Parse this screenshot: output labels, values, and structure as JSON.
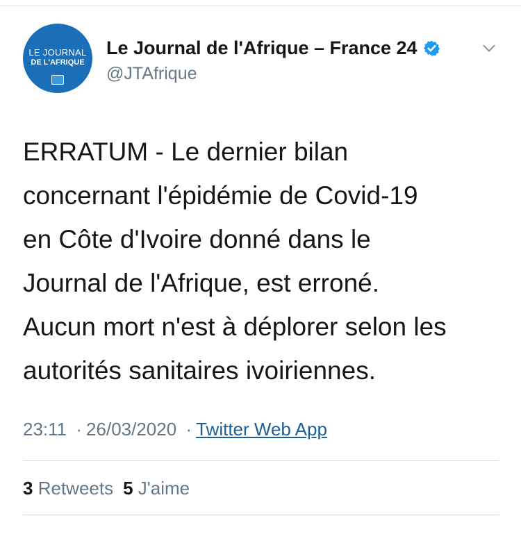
{
  "account": {
    "display_name": "Le Journal de l'Afrique – France 24",
    "handle": "@JTAfrique",
    "verified": true,
    "avatar_line1": "LE JOURNAL",
    "avatar_line2": "DE L'AFRIQUE",
    "avatar_color": "#1a6fb8"
  },
  "tweet": {
    "lines": [
      "ERRATUM - Le dernier bilan",
      "concernant l'épidémie de Covid-19",
      "en Côte d'Ivoire donné dans le",
      "Journal de l'Afrique, est erroné.",
      "Aucun mort n'est à déplorer selon les",
      "autorités sanitaires ivoiriennes."
    ],
    "time": "23:11",
    "separator": "·",
    "date": "26/03/2020",
    "source": "Twitter Web App"
  },
  "stats": {
    "retweets_count": "3",
    "retweets_label": "Retweets",
    "likes_count": "5",
    "likes_label": "J'aime"
  },
  "icons": {
    "verified": "verified-badge-icon",
    "menu": "chevron-down-icon"
  },
  "colors": {
    "link": "#1b5f97",
    "muted": "#657786",
    "verified": "#1d9bf0"
  }
}
